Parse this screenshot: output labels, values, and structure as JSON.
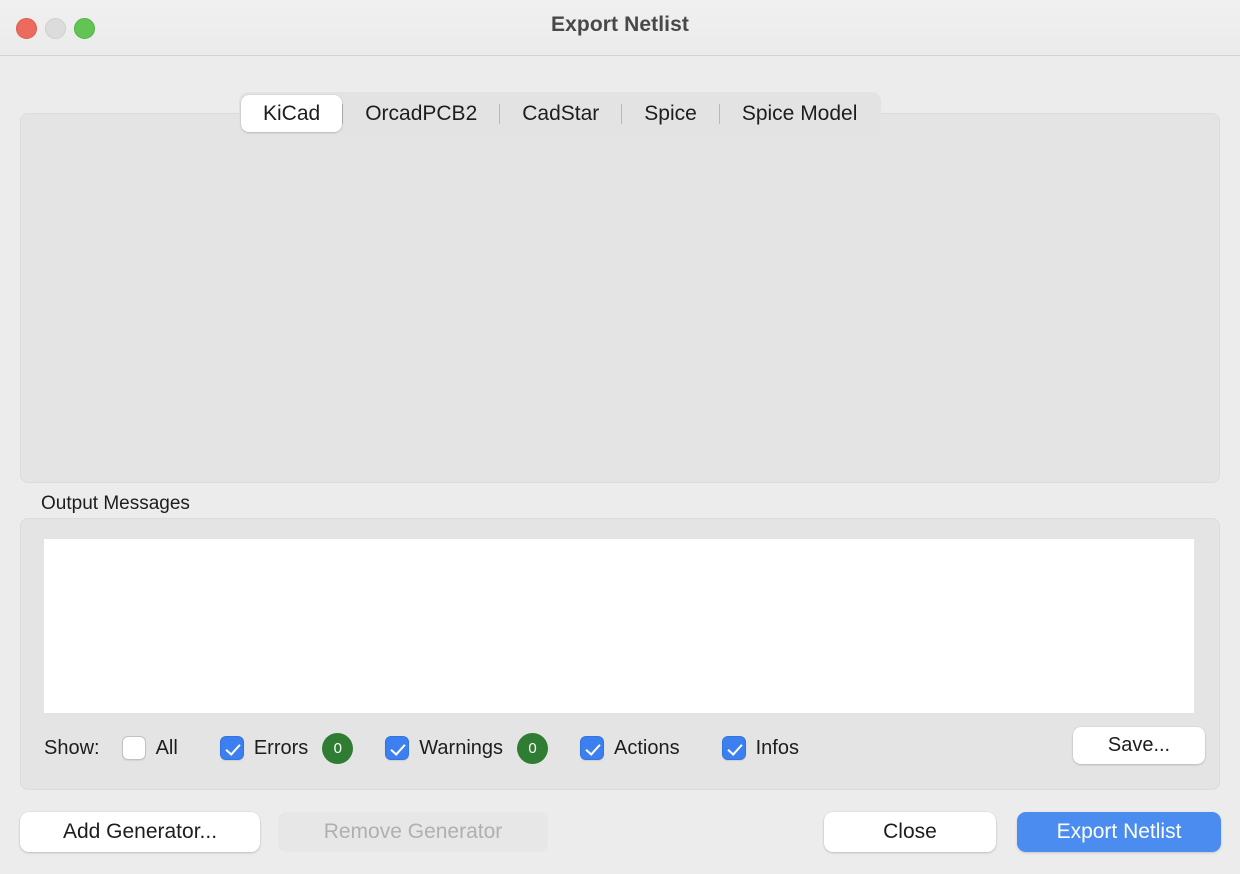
{
  "window": {
    "title": "Export Netlist",
    "traffic_lights": [
      {
        "name": "close",
        "color": "#ec6a5e"
      },
      {
        "name": "minimize",
        "color": "#dcdcdc"
      },
      {
        "name": "maximize",
        "color": "#61c454"
      }
    ]
  },
  "tabs": [
    {
      "label": "KiCad",
      "selected": true
    },
    {
      "label": "OrcadPCB2",
      "selected": false
    },
    {
      "label": "CadStar",
      "selected": false
    },
    {
      "label": "Spice",
      "selected": false
    },
    {
      "label": "Spice Model",
      "selected": false
    }
  ],
  "panel": {
    "content": ""
  },
  "output": {
    "label": "Output Messages",
    "messages": "",
    "show_label": "Show:",
    "filters": [
      {
        "label": "All",
        "checked": false,
        "badge": null
      },
      {
        "label": "Errors",
        "checked": true,
        "badge": "0"
      },
      {
        "label": "Warnings",
        "checked": true,
        "badge": "0"
      },
      {
        "label": "Actions",
        "checked": true,
        "badge": null
      },
      {
        "label": "Infos",
        "checked": true,
        "badge": null
      }
    ],
    "save_label": "Save..."
  },
  "footer": {
    "add_generator": "Add Generator...",
    "remove_generator": "Remove Generator",
    "close": "Close",
    "export": "Export Netlist"
  },
  "colors": {
    "accent": "#4a8cf0",
    "checkbox_on": "#3b7ff0",
    "badge_green": "#2e7d32",
    "window_bg": "#ececec",
    "panel_bg": "#e4e4e4"
  }
}
